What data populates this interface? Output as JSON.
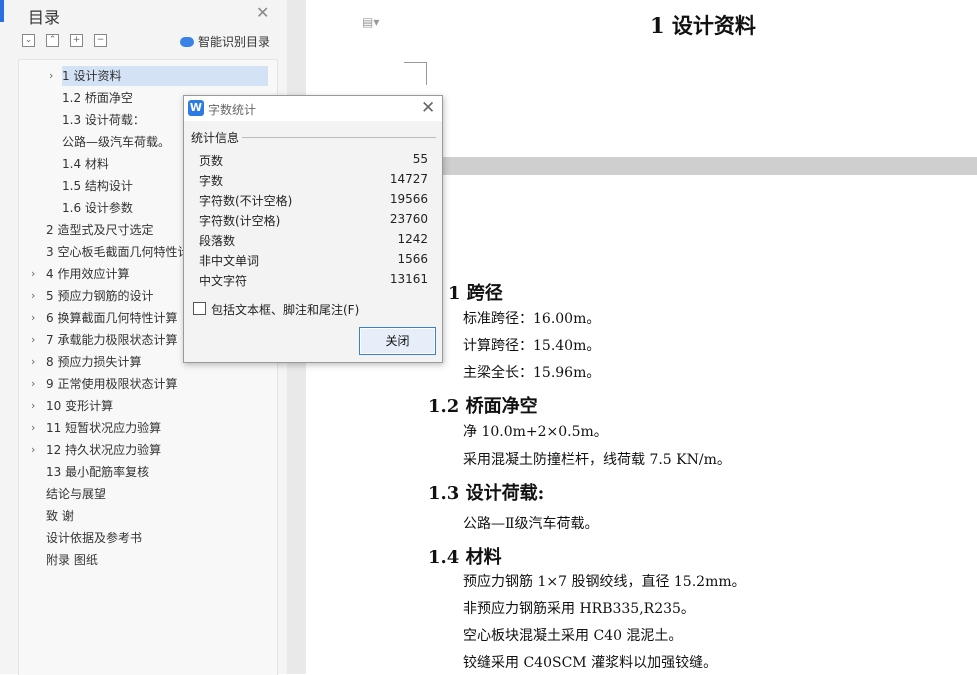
{
  "toc": {
    "title": "目录",
    "close_glyph": "✕",
    "tool_icons": [
      "collapse-icon",
      "expand-icon",
      "add-icon",
      "remove-icon"
    ],
    "smart_label": "智能识别目录",
    "items": [
      {
        "label": "1 设计资料",
        "expandable": true,
        "selected": true
      },
      {
        "label": "1.2 桥面净空"
      },
      {
        "label": "1.3 设计荷载："
      },
      {
        "label": "公路—级汽车荷载。"
      },
      {
        "label": "1.4 材料"
      },
      {
        "label": "1.5 结构设计"
      },
      {
        "label": "1.6  设计参数"
      },
      {
        "label": "2 造型式及尺寸选定"
      },
      {
        "label": "3 空心板毛截面几何特性计"
      },
      {
        "label": "4 作用效应计算",
        "expandable": true
      },
      {
        "label": "5 预应力钢筋的设计",
        "expandable": true
      },
      {
        "label": "6 换算截面几何特性计算",
        "expandable": true
      },
      {
        "label": "7 承载能力极限状态计算",
        "expandable": true
      },
      {
        "label": "8 预应力损失计算",
        "expandable": true
      },
      {
        "label": "9 正常使用极限状态计算",
        "expandable": true
      },
      {
        "label": "10 变形计算",
        "expandable": true
      },
      {
        "label": "11 短暂状况应力验算",
        "expandable": true
      },
      {
        "label": "12 持久状况应力验算",
        "expandable": true
      },
      {
        "label": "13  最小配筋率复核"
      },
      {
        "label": "结论与展望"
      },
      {
        "label": "致  谢"
      },
      {
        "label": "设计依据及参考书"
      },
      {
        "label": "附录    图纸"
      }
    ]
  },
  "document": {
    "title": "1 设计资料",
    "sections": [
      {
        "heading": "1 跨径",
        "lines": [
          "标准跨径：16.00m。",
          "计算跨径：15.40m。",
          "主梁全长：15.96m。"
        ]
      },
      {
        "heading": "1.2 桥面净空",
        "lines": [
          "净 10.0m+2×0.5m。",
          "采用混凝土防撞栏杆，线荷载 7.5 KN/m。"
        ]
      },
      {
        "heading": "1.3 设计荷载:",
        "lines": [
          "公路—Ⅱ级汽车荷载。"
        ]
      },
      {
        "heading": "1.4 材料",
        "lines": [
          "预应力钢筋 1×7 股钢绞线，直径 15.2mm。",
          "非预应力钢筋采用 HRB335,R235。",
          "空心板块混凝土采用 C40 混泥土。",
          "铰缝采用 C40SCM 灌浆料以加强铰缝。"
        ]
      }
    ]
  },
  "dialog": {
    "title": "字数统计",
    "logo_letter": "W",
    "group_label": "统计信息",
    "stats": [
      {
        "label": "页数",
        "value": "55"
      },
      {
        "label": "字数",
        "value": "14727"
      },
      {
        "label": "字符数(不计空格)",
        "value": "19566"
      },
      {
        "label": "字符数(计空格)",
        "value": "23760"
      },
      {
        "label": "段落数",
        "value": "1242"
      },
      {
        "label": "非中文单词",
        "value": "1566"
      },
      {
        "label": "中文字符",
        "value": "13161"
      }
    ],
    "checkbox_label": "包括文本框、脚注和尾注(F)",
    "checkbox_checked": false,
    "close_button": "关闭"
  },
  "colors": {
    "accent": "#2a6fe0",
    "selection": "#d4e2f6",
    "button_border": "#3c7fd1"
  }
}
